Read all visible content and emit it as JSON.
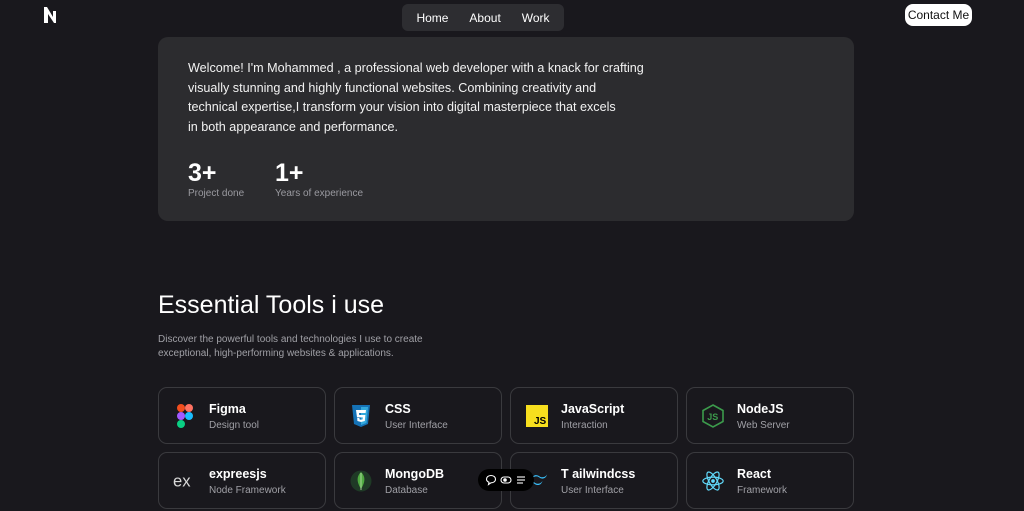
{
  "nav": {
    "links": [
      "Home",
      "About",
      "Work"
    ],
    "contact_label": "Contact Me"
  },
  "intro": {
    "lines": [
      "Welcome! I'm Mohammed , a professional web developer with a knack for crafting",
      "visually stunning and highly functional websites. Combining creativity and",
      "technical expertise,I transform your vision into digital masterpiece that excels",
      "in both appearance and performance."
    ],
    "stats": [
      {
        "value": "3+",
        "label": "Project done"
      },
      {
        "value": "1+",
        "label": "Years of experience"
      }
    ]
  },
  "tools": {
    "title": "Essential Tools i use",
    "description": [
      "Discover the powerful tools and technologies I use to create",
      "exceptional, high-performing websites & applications."
    ],
    "items": [
      {
        "name": "Figma",
        "sub": "Design tool",
        "icon": "figma-icon"
      },
      {
        "name": "CSS",
        "sub": "User Interface",
        "icon": "css-icon"
      },
      {
        "name": "JavaScript",
        "sub": "Interaction",
        "icon": "javascript-icon"
      },
      {
        "name": "NodeJS",
        "sub": "Web Server",
        "icon": "nodejs-icon"
      },
      {
        "name": "expreesjs",
        "sub": "Node Framework",
        "icon": "express-icon"
      },
      {
        "name": "MongoDB",
        "sub": "Database",
        "icon": "mongodb-icon"
      },
      {
        "name": "T ailwindcss",
        "sub": "User Interface",
        "icon": "tailwind-icon"
      },
      {
        "name": "React",
        "sub": "Framework",
        "icon": "react-icon"
      }
    ]
  },
  "colors": {
    "background": "#19181d",
    "card": "#2c2c2f",
    "nav": "#2d2d31"
  }
}
